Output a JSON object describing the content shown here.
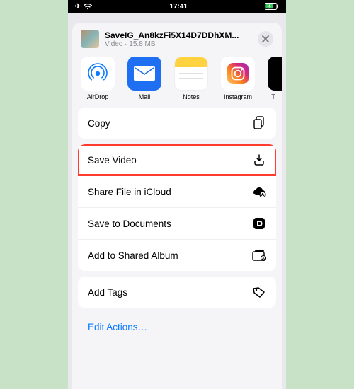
{
  "status": {
    "time": "17:41"
  },
  "file": {
    "name": "SaveIG_An8kzFi5X14D7DDhXM...",
    "kind": "Video",
    "size": "15.8 MB"
  },
  "apps": [
    {
      "key": "airdrop",
      "label": "AirDrop"
    },
    {
      "key": "mail",
      "label": "Mail"
    },
    {
      "key": "notes",
      "label": "Notes"
    },
    {
      "key": "instagram",
      "label": "Instagram"
    },
    {
      "key": "next",
      "label": "T"
    }
  ],
  "actions": {
    "copy": "Copy",
    "save_video": "Save Video",
    "share_icloud": "Share File in iCloud",
    "save_docs": "Save to Documents",
    "shared_album": "Add to Shared Album",
    "add_tags": "Add Tags"
  },
  "edit": "Edit Actions…",
  "highlight": "save_video"
}
